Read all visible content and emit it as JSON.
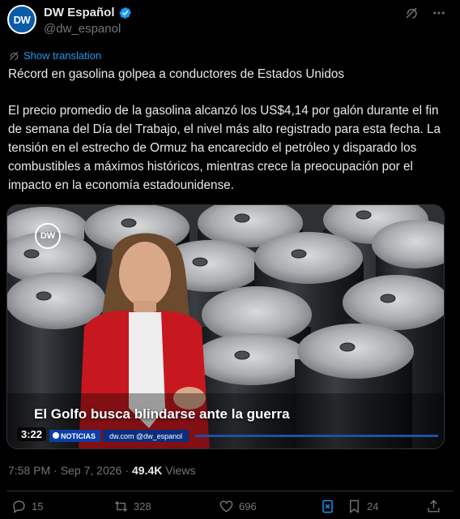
{
  "author": {
    "display_name": "DW Español",
    "handle": "@dw_espanol",
    "avatar_text": "DW",
    "verified": true
  },
  "translation_label": "Show translation",
  "headline": "Récord en gasolina golpea a conductores de Estados Unidos",
  "body": "El precio promedio de la gasolina alcanzó los US$4,14 por galón durante el fin de semana del Día del Trabajo, el nivel más alto registrado para esta fecha. La tensión en el estrecho de Ormuz ha encarecido el petróleo y disparado los combustibles a máximos históricos, mientras crece la preocupación por el impacto en la economía estadounidense.",
  "media": {
    "logo_text": "DW",
    "caption": "El Golfo busca blindarse ante la guerra",
    "duration": "3:22",
    "ticker_label": "NOTICIAS",
    "ticker_site": "dw.com  @dw_espanol"
  },
  "meta": {
    "time": "7:58 PM",
    "separator": "·",
    "date": "Sep 7, 2026",
    "views_count": "49.4K",
    "views_label": "Views"
  },
  "actions": {
    "replies": "15",
    "reposts": "328",
    "likes": "696",
    "bookmarks": "24"
  },
  "colors": {
    "accent": "#1d9bf0",
    "muted": "#71767b",
    "background": "#000000"
  },
  "icons": [
    "verified-badge-icon",
    "grok-icon",
    "more-icon",
    "translate-icon",
    "reply-icon",
    "repost-icon",
    "like-icon",
    "grok-analyze-icon",
    "bookmark-icon",
    "share-icon"
  ]
}
